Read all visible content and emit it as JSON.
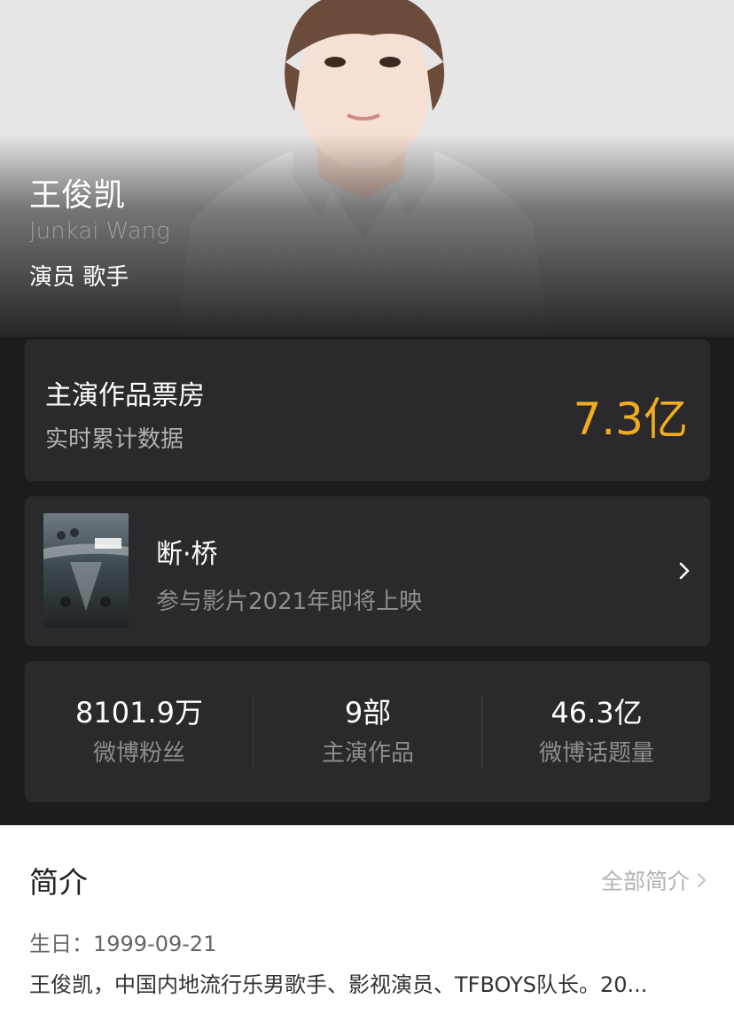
{
  "hero": {
    "name": "王俊凯",
    "english_name": "Junkai Wang",
    "roles": "演员 歌手"
  },
  "box_office": {
    "title": "主演作品票房",
    "subtitle": "实时累计数据",
    "value": "7.3亿",
    "value_color": "#f1ac1f"
  },
  "film": {
    "title": "断·桥",
    "subtitle": "参与影片2021年即将上映",
    "icon": "chevron-right-icon"
  },
  "stats": [
    {
      "value": "8101.9万",
      "label": "微博粉丝"
    },
    {
      "value": "9部",
      "label": "主演作品"
    },
    {
      "value": "46.3亿",
      "label": "微博话题量"
    }
  ],
  "intro": {
    "title": "简介",
    "more_label": "全部简介",
    "birthday": "生日：1999-09-21",
    "bio": "王俊凯，中国内地流行乐男歌手、影视演员、TFBOYS队长。20..."
  }
}
